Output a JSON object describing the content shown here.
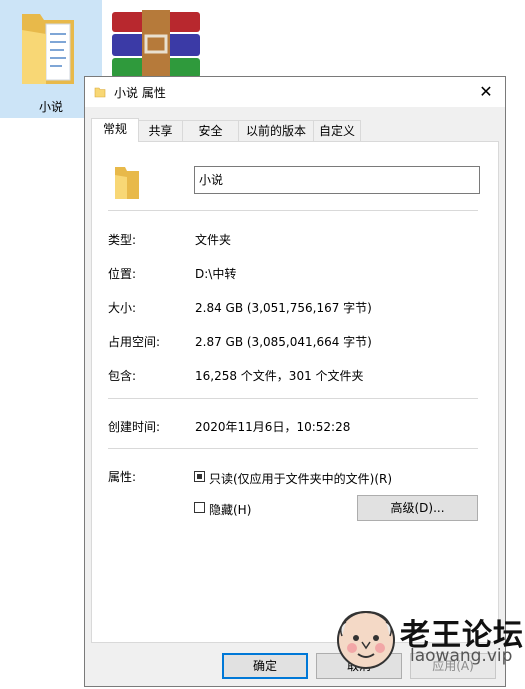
{
  "desktop": {
    "folder_label": "小说"
  },
  "dialog": {
    "title": "小说 属性",
    "close_glyph": "✕",
    "tabs": [
      "常规",
      "共享",
      "安全",
      "以前的版本",
      "自定义"
    ],
    "active_tab": "常规",
    "name_value": "小说",
    "props": [
      {
        "label": "类型:",
        "value": "文件夹"
      },
      {
        "label": "位置:",
        "value": "D:\\中转"
      },
      {
        "label": "大小:",
        "value": "2.84 GB (3,051,756,167 字节)"
      },
      {
        "label": "占用空间:",
        "value": "2.87 GB (3,085,041,664 字节)"
      },
      {
        "label": "包含:",
        "value": "16,258 个文件，301 个文件夹"
      },
      {
        "label": "创建时间:",
        "value": "2020年11月6日，10:52:28"
      }
    ],
    "attributes_label": "属性:",
    "readonly_label": "只读(仅应用于文件夹中的文件)(R)",
    "readonly_state": "indeterminate",
    "hidden_label": "隐藏(H)",
    "hidden_checked": false,
    "advanced_button": "高级(D)...",
    "ok_button": "确定",
    "cancel_button": "取消",
    "apply_button": "应用(A)"
  },
  "watermark": {
    "title": "老王论坛",
    "url": "laowang.vip"
  },
  "colors": {
    "folder": "#f8d775",
    "selection": "#cce4f7",
    "focus_border": "#0078d7"
  }
}
